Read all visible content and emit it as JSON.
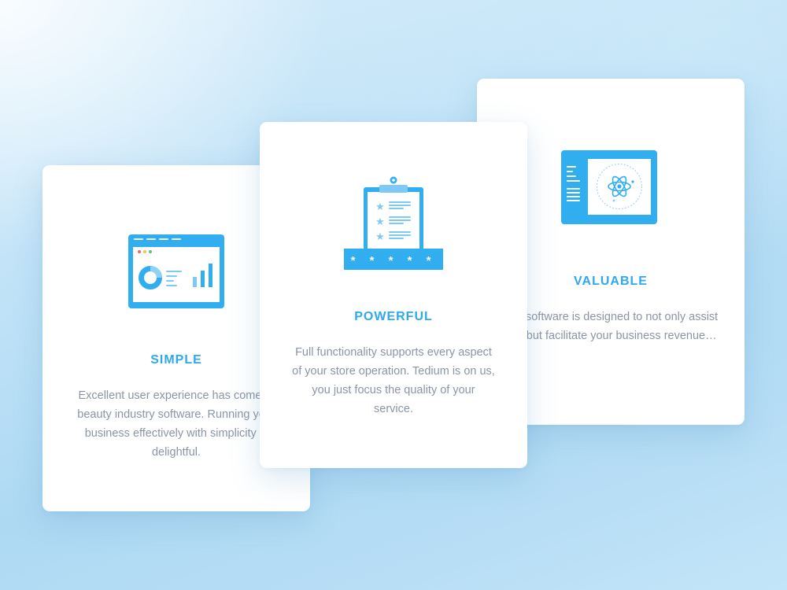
{
  "colors": {
    "accent": "#2ea8ef",
    "icon_primary": "#30aef0",
    "icon_light": "#7ccaf5",
    "text_muted": "#8a95a6",
    "card_bg": "#ffffff"
  },
  "cards": [
    {
      "id": "simple",
      "title": "SIMPLE",
      "icon": "dashboard-window-icon",
      "description": [
        "Excellent user experience has come to",
        "beauty industry software. Running your",
        "business effectively with simplicity is",
        "delightful."
      ]
    },
    {
      "id": "powerful",
      "title": "POWERFUL",
      "icon": "clipboard-rating-icon",
      "rating_text": "* * * * *",
      "description": [
        "Full functionality supports every aspect",
        "of your store operation. Tedium is on us,",
        "you just focus the quality of your",
        "service."
      ]
    },
    {
      "id": "valuable",
      "title": "VALUABLE",
      "icon": "atom-screen-icon",
      "description": [
        "Our software is designed to not only assist",
        "you but facilitate your business revenue…"
      ]
    }
  ]
}
